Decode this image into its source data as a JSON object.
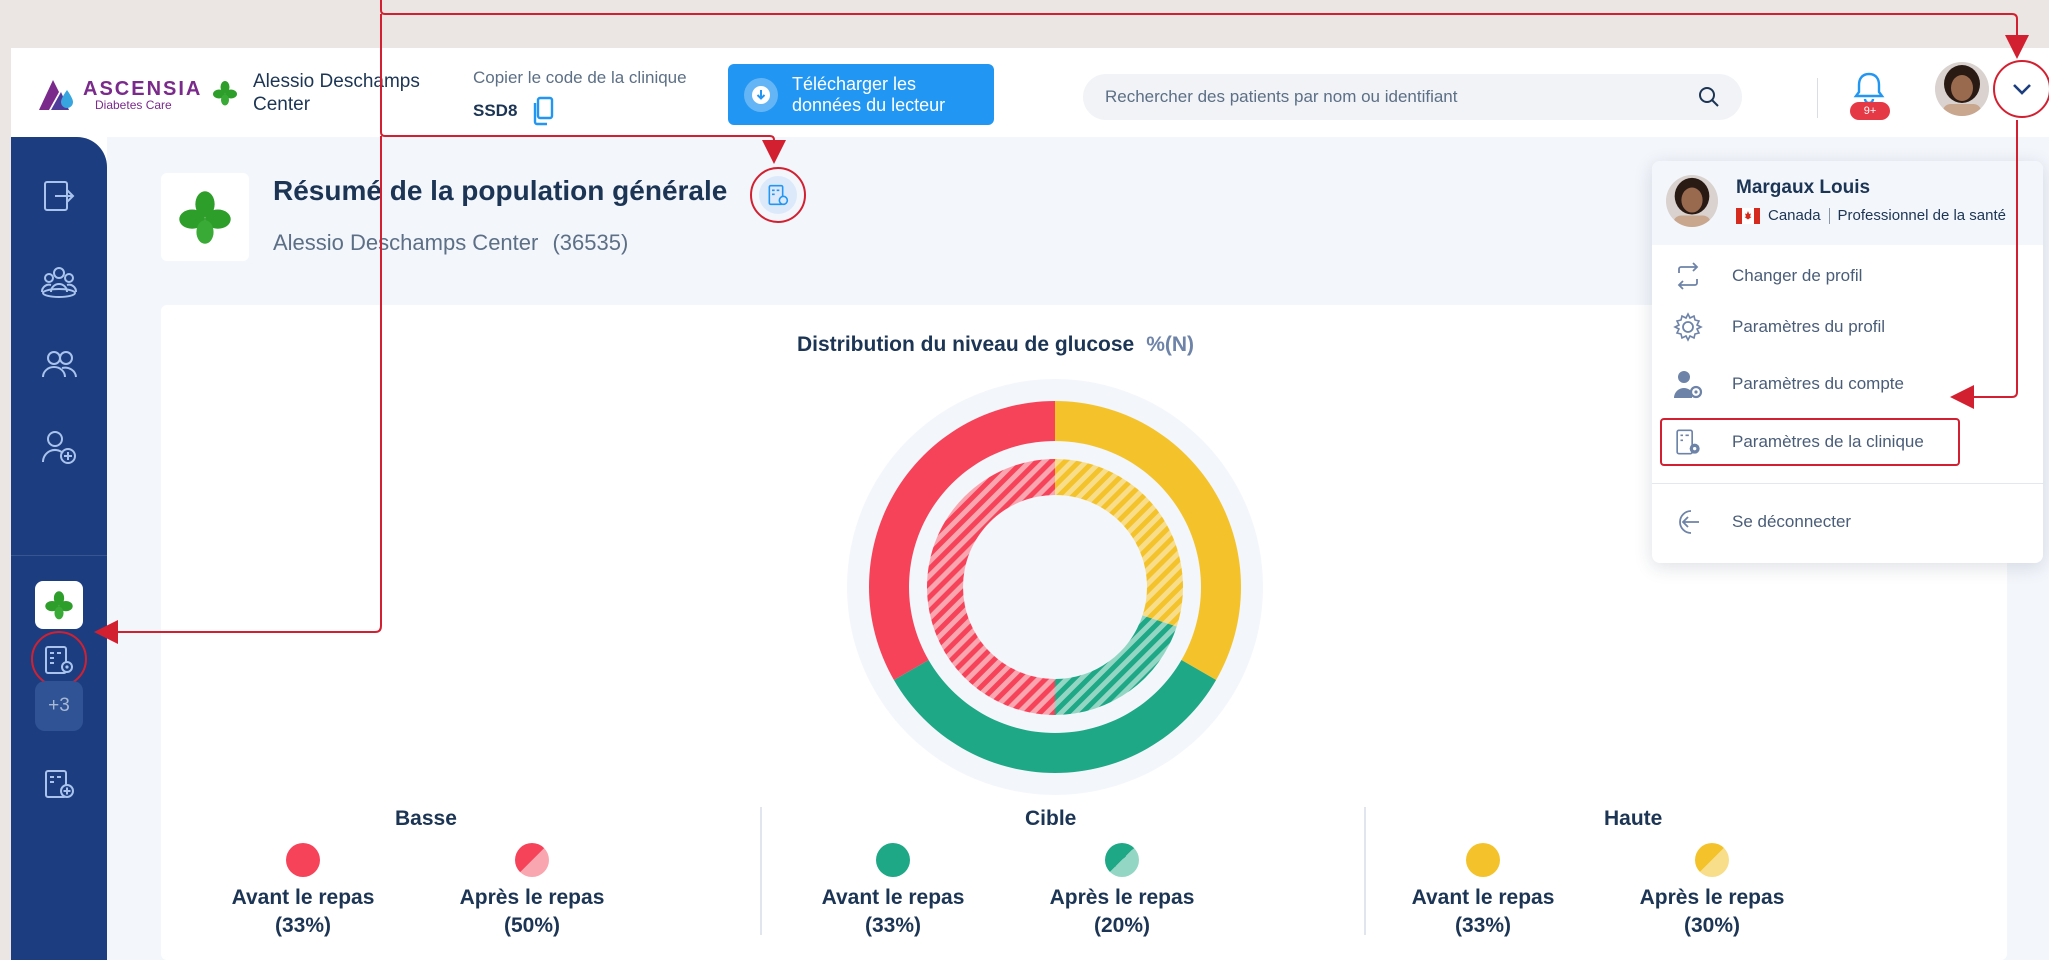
{
  "header": {
    "logo_name": "ASCENSIA",
    "logo_sub": "Diabetes Care",
    "clinic_label": "Alessio Deschamps Center",
    "copy_code_label": "Copier le code de la clinique",
    "clinic_code": "SSD8",
    "download_label": "Télécharger les données du lecteur",
    "search_placeholder": "Rechercher des patients par nom ou identifiant",
    "notification_badge": "9+"
  },
  "sidebar": {
    "items": [
      {
        "icon": "logout-arrow-icon"
      },
      {
        "icon": "population-icon"
      },
      {
        "icon": "patients-icon"
      },
      {
        "icon": "add-patient-icon"
      }
    ],
    "clinic_icon": "clover-icon",
    "settings_icon": "clinic-settings-icon",
    "more_label": "+3",
    "add_clinic_icon": "add-clinic-icon"
  },
  "main": {
    "title": "Résumé de la population générale",
    "subtitle": "Alessio Deschamps Center",
    "subtitle_count": "(36535)"
  },
  "chart_data": {
    "type": "pie",
    "title": "Distribution du niveau de glucose",
    "unit": "%(N)",
    "rings": [
      {
        "name": "Avant le repas",
        "values": [
          33,
          33,
          33
        ],
        "categories": [
          "Basse",
          "Cible",
          "Haute"
        ]
      },
      {
        "name": "Après le repas",
        "values": [
          50,
          20,
          30
        ],
        "categories": [
          "Basse",
          "Cible",
          "Haute"
        ]
      }
    ],
    "colors": {
      "Basse": "#f64359",
      "Cible": "#1ea886",
      "Haute": "#f4c32c"
    }
  },
  "legend": {
    "groups": [
      {
        "title": "Basse",
        "before_label": "Avant le repas",
        "before_pct": "(33%)",
        "after_label": "Après le repas",
        "after_pct": "(50%)",
        "color": "#f64359",
        "light": "#f9a6b0"
      },
      {
        "title": "Cible",
        "before_label": "Avant le repas",
        "before_pct": "(33%)",
        "after_label": "Après le repas",
        "after_pct": "(20%)",
        "color": "#1ea886",
        "light": "#94d6c4"
      },
      {
        "title": "Haute",
        "before_label": "Avant le repas",
        "before_pct": "(33%)",
        "after_label": "Après le repas",
        "after_pct": "(30%)",
        "color": "#f4c32c",
        "light": "#f8de8a"
      }
    ]
  },
  "profile_menu": {
    "name": "Margaux Louis",
    "country": "Canada",
    "role": "Professionnel de la santé",
    "items": [
      {
        "label": "Changer de profil",
        "icon": "switch-profile-icon"
      },
      {
        "label": "Paramètres du profil",
        "icon": "gear-icon"
      },
      {
        "label": "Paramètres du compte",
        "icon": "account-settings-icon"
      },
      {
        "label": "Paramètres de la clinique",
        "icon": "clinic-settings-icon"
      },
      {
        "label": "Se déconnecter",
        "icon": "logout-icon"
      }
    ]
  }
}
